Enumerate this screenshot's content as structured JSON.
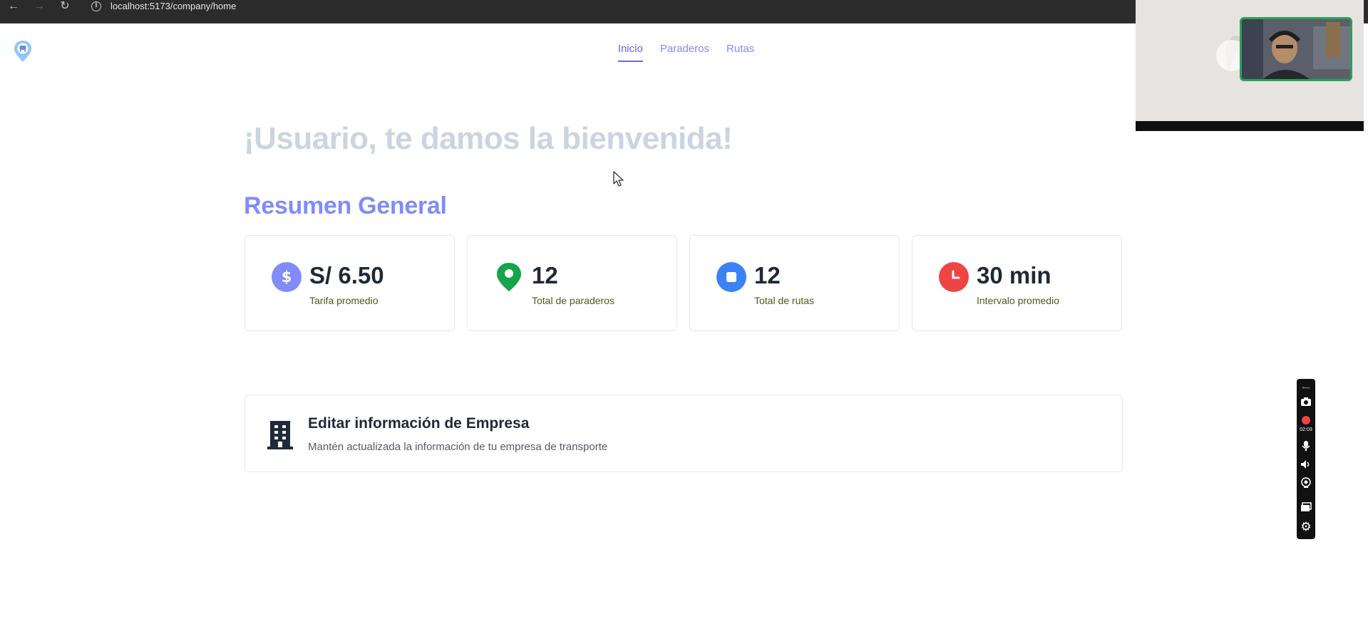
{
  "browser": {
    "url_host": "localhost:",
    "url_rest": "5173/company/home",
    "back_icon": "arrow-left-icon",
    "forward_icon": "arrow-right-icon",
    "reload_icon": "reload-icon"
  },
  "nav": {
    "items": [
      {
        "label": "Inicio",
        "active": true
      },
      {
        "label": "Paraderos",
        "active": false
      },
      {
        "label": "Rutas",
        "active": false
      }
    ]
  },
  "main": {
    "welcome": "¡Usuario, te damos la bienvenida!",
    "section_title": "Resumen General",
    "stats": [
      {
        "value": "S/ 6.50",
        "label": "Tarifa promedio",
        "icon": "dollar-icon",
        "color": "#818cf8"
      },
      {
        "value": "12",
        "label": "Total de paraderos",
        "icon": "map-pin-icon",
        "color": "#16a34a"
      },
      {
        "value": "12",
        "label": "Total de rutas",
        "icon": "route-icon",
        "color": "#3b82f6"
      },
      {
        "value": "30 min",
        "label": "Intervalo promedio",
        "icon": "clock-icon",
        "color": "#ef4444"
      }
    ],
    "company_card": {
      "title": "Editar información de Empresa",
      "description": "Mantén actualizada la información de tu empresa de transporte"
    }
  },
  "recorder": {
    "time": "02:03"
  },
  "colors": {
    "accent": "#6366f1",
    "accent_light": "#818cf8",
    "welcome": "#cbd5e1"
  }
}
